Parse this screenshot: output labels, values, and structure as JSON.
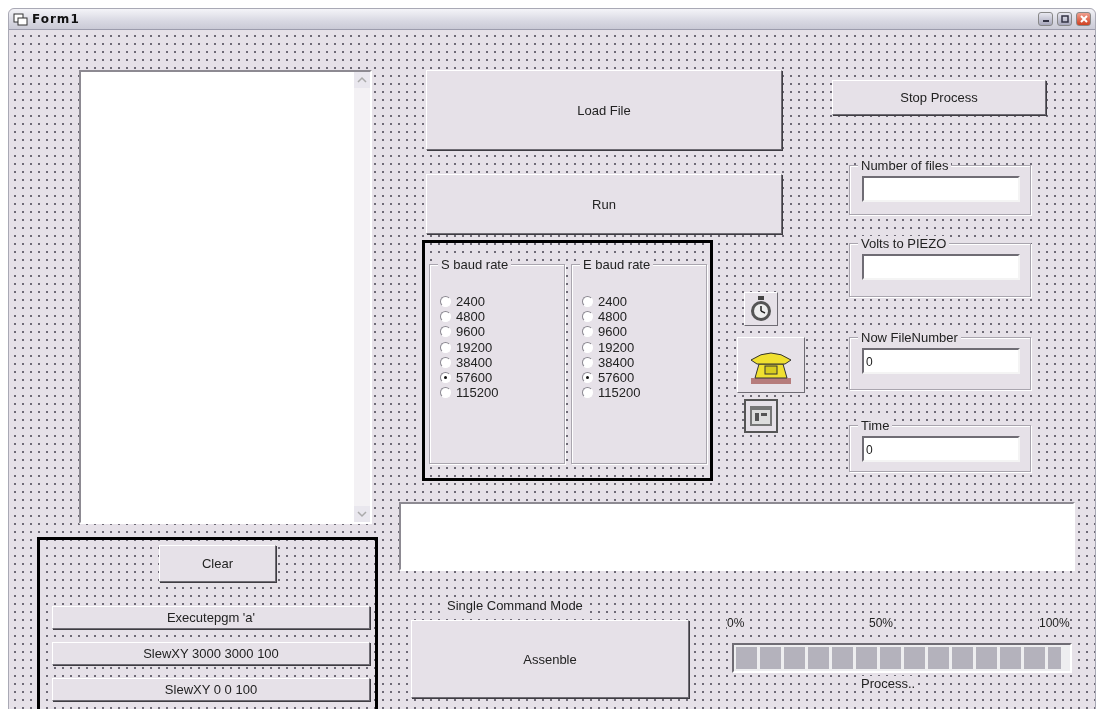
{
  "window": {
    "title": "Form1"
  },
  "load_button": "Load File",
  "run_button": "Run",
  "stop_button": "Stop Process",
  "baud_groups": [
    {
      "title": "S baud rate",
      "options": [
        {
          "label": "2400",
          "selected": false
        },
        {
          "label": "4800",
          "selected": false
        },
        {
          "label": "9600",
          "selected": false
        },
        {
          "label": "19200",
          "selected": false
        },
        {
          "label": "38400",
          "selected": false
        },
        {
          "label": "57600",
          "selected": true
        },
        {
          "label": "115200",
          "selected": false
        }
      ]
    },
    {
      "title": "E baud rate",
      "options": [
        {
          "label": "2400",
          "selected": false
        },
        {
          "label": "4800",
          "selected": false
        },
        {
          "label": "9600",
          "selected": false
        },
        {
          "label": "19200",
          "selected": false
        },
        {
          "label": "38400",
          "selected": false
        },
        {
          "label": "57600",
          "selected": true
        },
        {
          "label": "115200",
          "selected": false
        }
      ]
    }
  ],
  "fields": [
    {
      "label": "Number of files"
    },
    {
      "label": "Volts to PIEZO"
    },
    {
      "label": "Now FileNumber",
      "value": "0"
    },
    {
      "label": "Time",
      "value": "0"
    }
  ],
  "clear_button": "Clear",
  "command_buttons": [
    "Executepgm 'a'",
    "SlewXY 3000 3000 100",
    "SlewXY 0 0 100"
  ],
  "single_command": {
    "label": "Single Command Mode",
    "button": "Assenble"
  },
  "progress": {
    "ticks": [
      "0%",
      "50%",
      "100%"
    ],
    "level": 0.98,
    "caption": "Process.."
  }
}
